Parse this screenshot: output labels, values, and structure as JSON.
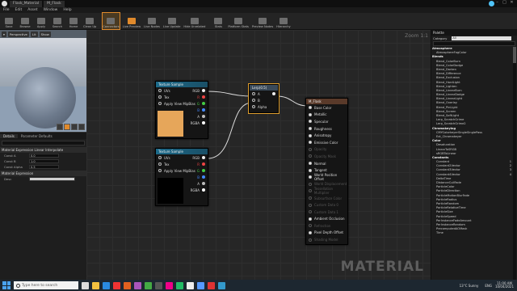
{
  "window": {
    "tab_title": "Flask_Material",
    "doc_tab": "M_Flask"
  },
  "menu": [
    "File",
    "Edit",
    "Asset",
    "Window",
    "Help"
  ],
  "toolbar": [
    {
      "label": "Save",
      "icon": "save-icon"
    },
    {
      "label": "Browse",
      "icon": "browse-icon"
    },
    {
      "label": "Apply",
      "icon": "apply-icon"
    },
    {
      "label": "Search",
      "icon": "search-icon"
    },
    {
      "label": "Home",
      "icon": "home-icon"
    },
    {
      "label": "Clean Up",
      "icon": "cleanup-icon"
    },
    {
      "label": "Connectors",
      "icon": "connectors-icon",
      "hl": true
    },
    {
      "label": "Live Preview",
      "icon": "live-preview-icon",
      "active": true
    },
    {
      "label": "Live Nodes",
      "icon": "live-nodes-icon"
    },
    {
      "label": "Live Update",
      "icon": "live-update-icon"
    },
    {
      "label": "Hide Unrelated",
      "icon": "hide-unrelated-icon"
    },
    {
      "label": "Stats",
      "icon": "stats-icon"
    },
    {
      "label": "Platform Stats",
      "icon": "platform-stats-icon"
    },
    {
      "label": "Preview Nodes",
      "icon": "preview-nodes-icon"
    },
    {
      "label": "Hierarchy",
      "icon": "hierarchy-icon"
    }
  ],
  "viewport": {
    "perspective": "Perspective",
    "lit": "Lit",
    "show": "Show"
  },
  "details": {
    "tab1": "Details",
    "tab2": "Parameter Defaults",
    "cat1": "Material Expression Linear Interpolate",
    "rows": [
      {
        "label": "Const A",
        "value": "0.0"
      },
      {
        "label": "Const B",
        "value": "1.0"
      },
      {
        "label": "Const Alpha",
        "value": "0.5"
      }
    ],
    "cat2": "Material Expression",
    "desc_label": "Desc"
  },
  "graph": {
    "zoom": "Zoom 1:1",
    "watermark": "MATERIAL",
    "tex1": {
      "title": "Texture Sample",
      "pins": [
        "UVs",
        "Tex",
        "Apply View MipBias"
      ],
      "outs": [
        "RGB",
        "R",
        "G",
        "B",
        "A",
        "RGBA"
      ]
    },
    "tex2": {
      "title": "Texture Sample",
      "pins": [
        "UVs",
        "Tex",
        "Apply View MipBias"
      ],
      "outs": [
        "RGB",
        "R",
        "G",
        "B",
        "A",
        "RGBA"
      ]
    },
    "lerp": {
      "title": "Lerp(0.5)",
      "pins": [
        "A",
        "B",
        "Alpha"
      ]
    },
    "result": {
      "title": "M_Flask",
      "pins": [
        "Base Color",
        "Metallic",
        "Specular",
        "Roughness",
        "Anisotropy",
        "Emissive Color",
        "Opacity",
        "Opacity Mask",
        "Normal",
        "Tangent",
        "World Position Offset",
        "World Displacement",
        "Tessellation Multiplier",
        "Subsurface Color",
        "Custom Data 0",
        "Custom Data 1",
        "Ambient Occlusion",
        "Refraction",
        "Pixel Depth Offset",
        "Shading Model"
      ]
    },
    "swatch_color": "#e6a65a"
  },
  "palette": {
    "title": "Palette",
    "category_label": "Category",
    "category_value": "All",
    "items": [
      {
        "t": "Atmosphere",
        "h": true
      },
      {
        "t": "AtmosphereFogColor"
      },
      {
        "t": "Blends",
        "h": true
      },
      {
        "t": "Blend_ColorBurn"
      },
      {
        "t": "Blend_ColorDodge"
      },
      {
        "t": "Blend_Darken"
      },
      {
        "t": "Blend_Difference"
      },
      {
        "t": "Blend_Exclusion"
      },
      {
        "t": "Blend_HardLight"
      },
      {
        "t": "Blend_Lighten"
      },
      {
        "t": "Blend_LinearBurn"
      },
      {
        "t": "Blend_LinearDodge"
      },
      {
        "t": "Blend_LinearLight"
      },
      {
        "t": "Blend_Overlay"
      },
      {
        "t": "Blend_PinLight"
      },
      {
        "t": "Blend_Screen"
      },
      {
        "t": "Blend_SoftLight"
      },
      {
        "t": "Lerp_ScratchGrime"
      },
      {
        "t": "Lerp_ScratchGrime2"
      },
      {
        "t": "Chromakeying",
        "h": true
      },
      {
        "t": "CMYColorkeyerSingleSinglePass"
      },
      {
        "t": "Ext_Chromakeyer"
      },
      {
        "t": "Color",
        "h": true
      },
      {
        "t": "Desaturation"
      },
      {
        "t": "LinearToSRGB"
      },
      {
        "t": "sRGBToLinear"
      },
      {
        "t": "Constants",
        "h": true
      },
      {
        "t": "Constant",
        "s": "1"
      },
      {
        "t": "Constant2Vector",
        "s": "2"
      },
      {
        "t": "Constant3Vector",
        "s": "3"
      },
      {
        "t": "Constant4Vector",
        "s": "4"
      },
      {
        "t": "DeltaTime"
      },
      {
        "t": "DistanceCullFade"
      },
      {
        "t": "ParticleColor"
      },
      {
        "t": "ParticleDirection"
      },
      {
        "t": "ParticleMotionBlurFade"
      },
      {
        "t": "ParticleRadius"
      },
      {
        "t": "ParticleRandom"
      },
      {
        "t": "ParticleRelativeTime"
      },
      {
        "t": "ParticleSize"
      },
      {
        "t": "ParticleSpeed"
      },
      {
        "t": "PerInstanceFadeAmount"
      },
      {
        "t": "PerInstanceRandom"
      },
      {
        "t": "PrecomputedAOMask"
      },
      {
        "t": "Time"
      }
    ]
  },
  "taskbar": {
    "search_placeholder": "Type here to search",
    "weather": "13°C  Sunny",
    "lang": "ENG",
    "time": "11:00 AM",
    "date": "10/04/2021"
  }
}
